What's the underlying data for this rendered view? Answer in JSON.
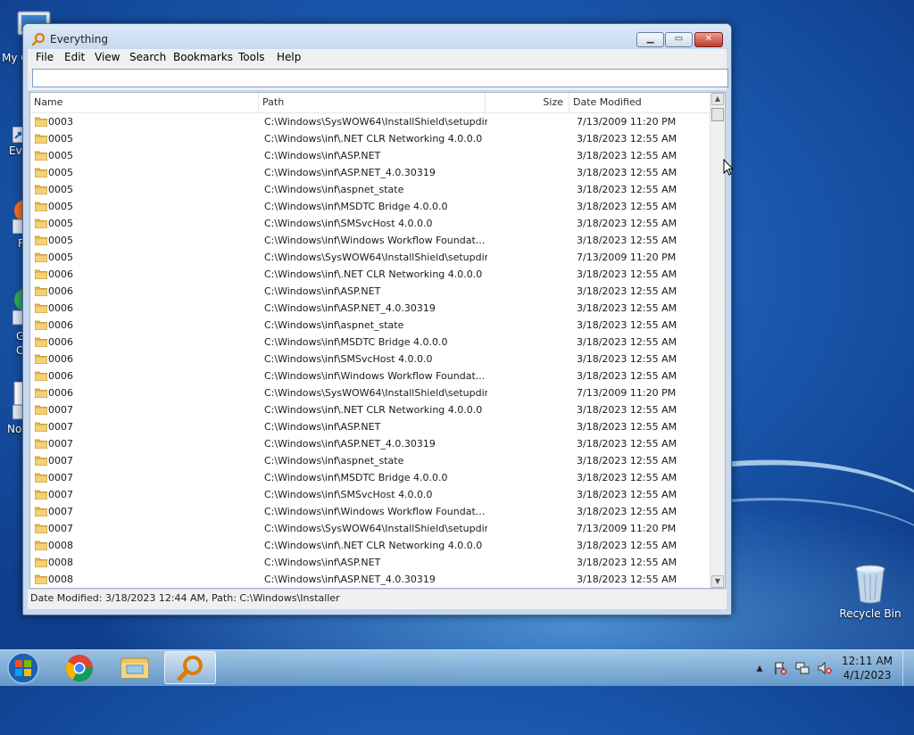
{
  "desktop": {
    "partial_labels": [
      "My C",
      "Ev",
      "F",
      "G",
      "C",
      "No"
    ],
    "recycle_bin_label": "Recycle Bin"
  },
  "window": {
    "title": "Everything",
    "menu": [
      "File",
      "Edit",
      "View",
      "Search",
      "Bookmarks",
      "Tools",
      "Help"
    ],
    "search": {
      "value": "",
      "placeholder": ""
    },
    "columns": {
      "name": "Name",
      "path": "Path",
      "size": "Size",
      "date": "Date Modified"
    },
    "rows": [
      {
        "name": "0003",
        "path": "C:\\Windows\\SysWOW64\\InstallShield\\setupdir",
        "size": "",
        "date": "7/13/2009 11:20 PM"
      },
      {
        "name": "0005",
        "path": "C:\\Windows\\inf\\.NET CLR Networking 4.0.0.0",
        "size": "",
        "date": "3/18/2023 12:55 AM"
      },
      {
        "name": "0005",
        "path": "C:\\Windows\\inf\\ASP.NET",
        "size": "",
        "date": "3/18/2023 12:55 AM"
      },
      {
        "name": "0005",
        "path": "C:\\Windows\\inf\\ASP.NET_4.0.30319",
        "size": "",
        "date": "3/18/2023 12:55 AM"
      },
      {
        "name": "0005",
        "path": "C:\\Windows\\inf\\aspnet_state",
        "size": "",
        "date": "3/18/2023 12:55 AM"
      },
      {
        "name": "0005",
        "path": "C:\\Windows\\inf\\MSDTC Bridge 4.0.0.0",
        "size": "",
        "date": "3/18/2023 12:55 AM"
      },
      {
        "name": "0005",
        "path": "C:\\Windows\\inf\\SMSvcHost 4.0.0.0",
        "size": "",
        "date": "3/18/2023 12:55 AM"
      },
      {
        "name": "0005",
        "path": "C:\\Windows\\inf\\Windows Workflow Foundat...",
        "size": "",
        "date": "3/18/2023 12:55 AM"
      },
      {
        "name": "0005",
        "path": "C:\\Windows\\SysWOW64\\InstallShield\\setupdir",
        "size": "",
        "date": "7/13/2009 11:20 PM"
      },
      {
        "name": "0006",
        "path": "C:\\Windows\\inf\\.NET CLR Networking 4.0.0.0",
        "size": "",
        "date": "3/18/2023 12:55 AM"
      },
      {
        "name": "0006",
        "path": "C:\\Windows\\inf\\ASP.NET",
        "size": "",
        "date": "3/18/2023 12:55 AM"
      },
      {
        "name": "0006",
        "path": "C:\\Windows\\inf\\ASP.NET_4.0.30319",
        "size": "",
        "date": "3/18/2023 12:55 AM"
      },
      {
        "name": "0006",
        "path": "C:\\Windows\\inf\\aspnet_state",
        "size": "",
        "date": "3/18/2023 12:55 AM"
      },
      {
        "name": "0006",
        "path": "C:\\Windows\\inf\\MSDTC Bridge 4.0.0.0",
        "size": "",
        "date": "3/18/2023 12:55 AM"
      },
      {
        "name": "0006",
        "path": "C:\\Windows\\inf\\SMSvcHost 4.0.0.0",
        "size": "",
        "date": "3/18/2023 12:55 AM"
      },
      {
        "name": "0006",
        "path": "C:\\Windows\\inf\\Windows Workflow Foundat...",
        "size": "",
        "date": "3/18/2023 12:55 AM"
      },
      {
        "name": "0006",
        "path": "C:\\Windows\\SysWOW64\\InstallShield\\setupdir",
        "size": "",
        "date": "7/13/2009 11:20 PM"
      },
      {
        "name": "0007",
        "path": "C:\\Windows\\inf\\.NET CLR Networking 4.0.0.0",
        "size": "",
        "date": "3/18/2023 12:55 AM"
      },
      {
        "name": "0007",
        "path": "C:\\Windows\\inf\\ASP.NET",
        "size": "",
        "date": "3/18/2023 12:55 AM"
      },
      {
        "name": "0007",
        "path": "C:\\Windows\\inf\\ASP.NET_4.0.30319",
        "size": "",
        "date": "3/18/2023 12:55 AM"
      },
      {
        "name": "0007",
        "path": "C:\\Windows\\inf\\aspnet_state",
        "size": "",
        "date": "3/18/2023 12:55 AM"
      },
      {
        "name": "0007",
        "path": "C:\\Windows\\inf\\MSDTC Bridge 4.0.0.0",
        "size": "",
        "date": "3/18/2023 12:55 AM"
      },
      {
        "name": "0007",
        "path": "C:\\Windows\\inf\\SMSvcHost 4.0.0.0",
        "size": "",
        "date": "3/18/2023 12:55 AM"
      },
      {
        "name": "0007",
        "path": "C:\\Windows\\inf\\Windows Workflow Foundat...",
        "size": "",
        "date": "3/18/2023 12:55 AM"
      },
      {
        "name": "0007",
        "path": "C:\\Windows\\SysWOW64\\InstallShield\\setupdir",
        "size": "",
        "date": "7/13/2009 11:20 PM"
      },
      {
        "name": "0008",
        "path": "C:\\Windows\\inf\\.NET CLR Networking 4.0.0.0",
        "size": "",
        "date": "3/18/2023 12:55 AM"
      },
      {
        "name": "0008",
        "path": "C:\\Windows\\inf\\ASP.NET",
        "size": "",
        "date": "3/18/2023 12:55 AM"
      },
      {
        "name": "0008",
        "path": "C:\\Windows\\inf\\ASP.NET_4.0.30319",
        "size": "",
        "date": "3/18/2023 12:55 AM"
      }
    ],
    "status": "Date Modified: 3/18/2023 12:44 AM, Path: C:\\Windows\\Installer"
  },
  "taskbar": {
    "pinned": [
      "chrome-icon",
      "explorer-icon",
      "everything-icon"
    ],
    "tray": {
      "time": "12:11 AM",
      "date": "4/1/2023"
    }
  },
  "colors": {
    "folder": "#e7b94d",
    "accent": "#1c5db3"
  }
}
